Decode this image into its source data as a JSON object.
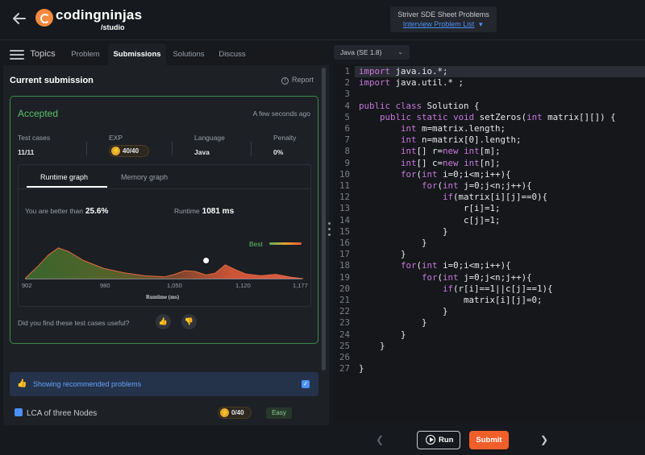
{
  "header": {
    "brand": "codingninjas",
    "brand_sub": "/studio",
    "sheet_title": "Striver SDE Sheet Problems",
    "sheet_link": "Interview Problem List"
  },
  "tabs": [
    {
      "label": "Topics"
    },
    {
      "label": "Problem"
    },
    {
      "label": "Submissions"
    },
    {
      "label": "Solutions"
    },
    {
      "label": "Discuss"
    }
  ],
  "submission": {
    "title": "Current submission",
    "report": "Report",
    "status": "Accepted",
    "time_ago": "A few seconds ago",
    "stats": [
      {
        "label": "Test cases",
        "value": "11/11"
      },
      {
        "label": "EXP",
        "value": "40/40"
      },
      {
        "label": "Language",
        "value": "Java"
      },
      {
        "label": "Penalty",
        "value": "0%"
      }
    ],
    "graph_tabs": [
      "Runtime graph",
      "Memory graph"
    ],
    "better_label": "You are better than",
    "better_value": "25.6%",
    "runtime_label": "Runtime",
    "runtime_value": "1081 ms",
    "best_label": "Best",
    "useful_question": "Did you find these test cases useful?"
  },
  "chart_data": {
    "type": "area",
    "xlabel": "Runtime (ms)",
    "xticks": [
      "902",
      "980",
      "1,050",
      "1,120",
      "1,177"
    ],
    "xlim": [
      902,
      1177
    ],
    "marker_x": 1081,
    "series": [
      {
        "x": [
          902,
          915,
          925,
          935,
          945,
          960,
          980,
          1000,
          1020,
          1040,
          1050,
          1060,
          1070,
          1081,
          1090,
          1100,
          1110,
          1120,
          1135,
          1150,
          1165,
          1177
        ],
        "values": [
          0,
          0.35,
          0.65,
          0.85,
          0.75,
          0.5,
          0.28,
          0.16,
          0.08,
          0.05,
          0.12,
          0.22,
          0.2,
          0.1,
          0.15,
          0.38,
          0.25,
          0.13,
          0.08,
          0.12,
          0.04,
          0
        ]
      }
    ]
  },
  "recommend": {
    "label": "Showing recommended problems",
    "problem": "LCA of three Nodes",
    "exp": "0/40",
    "difficulty": "Easy"
  },
  "editor": {
    "language": "Java (SE 1.8)",
    "lines": [
      "import java.io.*;",
      "import java.util.* ;",
      "",
      "public class Solution {",
      "    public static void setZeros(int matrix[][]) {",
      "        int m=matrix.length;",
      "        int n=matrix[0].length;",
      "        int[] r=new int[m];",
      "        int[] c=new int[n];",
      "        for(int i=0;i<m;i++){",
      "            for(int j=0;j<n;j++){",
      "                if(matrix[i][j]==0){",
      "                    r[i]=1;",
      "                    c[j]=1;",
      "                }",
      "            }",
      "        }",
      "        for(int i=0;i<m;i++){",
      "            for(int j=0;j<n;j++){",
      "                if(r[i]==1||c[j]==1){",
      "                    matrix[i][j]=0;",
      "                }",
      "            }",
      "        }",
      "    }",
      "",
      "}"
    ]
  },
  "actions": {
    "run": "Run",
    "submit": "Submit"
  }
}
